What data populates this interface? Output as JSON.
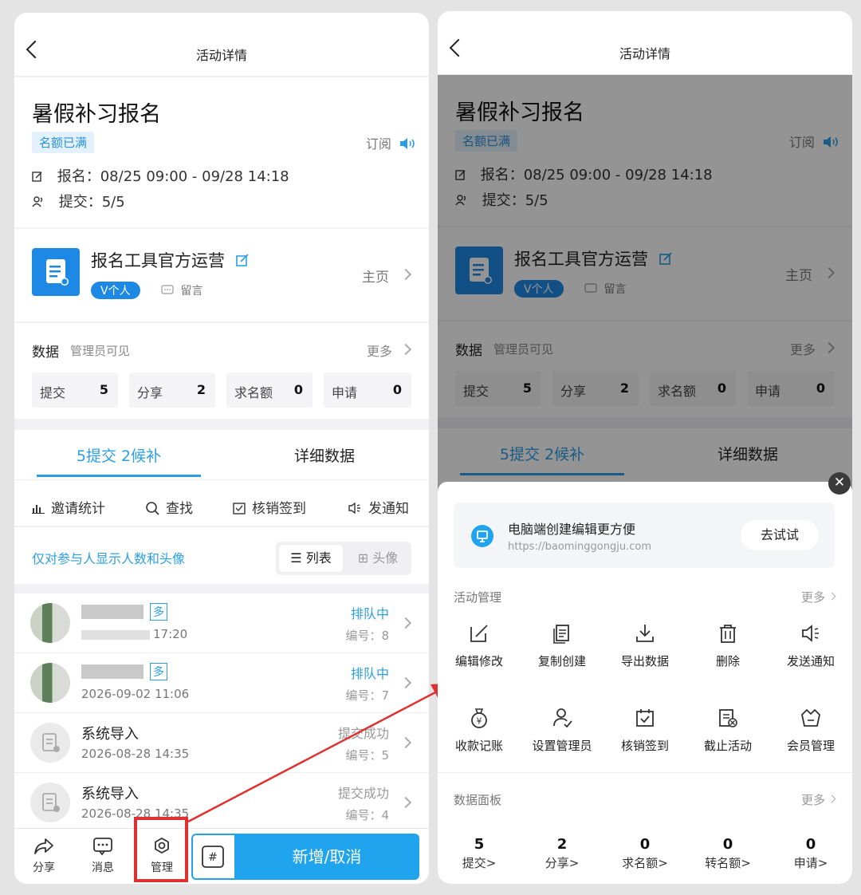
{
  "header": {
    "title": "活动详情"
  },
  "event": {
    "title": "暑假补习报名",
    "status_badge": "名额已满",
    "subscribe": "订阅",
    "signup_label": "报名：",
    "signup_period": "08/25 09:00 - 09/28 14:18",
    "submit_label": "提交：",
    "submit_value": "5/5"
  },
  "organizer": {
    "name": "报名工具官方运营",
    "badge": "V个人",
    "message": "留言",
    "homepage": "主页"
  },
  "data_section": {
    "title": "数据",
    "subtitle": "管理员可见",
    "more": "更多",
    "stats": [
      {
        "label": "提交",
        "value": "5"
      },
      {
        "label": "分享",
        "value": "2"
      },
      {
        "label": "求名额",
        "value": "0"
      },
      {
        "label": "申请",
        "value": "0"
      }
    ]
  },
  "tabs": [
    {
      "label": "5提交 2候补"
    },
    {
      "label": "详细数据"
    }
  ],
  "tools": [
    {
      "label": "邀请统计"
    },
    {
      "label": "查找"
    },
    {
      "label": "核销签到"
    },
    {
      "label": "发通知"
    }
  ],
  "list_options": {
    "note": "仅对参与人显示人数和头像",
    "list_view": "列表",
    "avatar_view": "头像"
  },
  "participants": [
    {
      "tag": "多",
      "time": "17:20",
      "status": "排队中",
      "number": "编号：8"
    },
    {
      "tag": "多",
      "time": "2026-09-02 11:06",
      "status": "排队中",
      "number": "编号：7"
    },
    {
      "name": "系统导入",
      "time": "2026-08-28 14:35",
      "status": "提交成功",
      "number": "编号：5"
    },
    {
      "name": "系统导入",
      "time": "2026-08-28 14:35",
      "status": "提交成功",
      "number": "编号：4"
    }
  ],
  "bottom_bar": {
    "share": "分享",
    "messages": "消息",
    "manage": "管理",
    "primary": "新增/取消"
  },
  "sheet": {
    "promo_title": "电脑端创建编辑更方便",
    "promo_url": "https://baominggongju.com",
    "promo_button": "去试试",
    "manage_title": "活动管理",
    "manage_more": "更多",
    "manage_items": [
      {
        "label": "编辑修改",
        "icon": "edit-icon"
      },
      {
        "label": "复制创建",
        "icon": "copy-icon"
      },
      {
        "label": "导出数据",
        "icon": "download-icon"
      },
      {
        "label": "删除",
        "icon": "trash-icon"
      },
      {
        "label": "发送通知",
        "icon": "speaker-icon"
      },
      {
        "label": "收款记账",
        "icon": "money-bag-icon"
      },
      {
        "label": "设置管理员",
        "icon": "admin-icon"
      },
      {
        "label": "核销签到",
        "icon": "check-calendar-icon"
      },
      {
        "label": "截止活动",
        "icon": "stop-icon"
      },
      {
        "label": "会员管理",
        "icon": "basket-icon"
      }
    ],
    "panel_title": "数据面板",
    "panel_more": "更多",
    "panel_items": [
      {
        "value": "5",
        "label": "提交>"
      },
      {
        "value": "2",
        "label": "分享>"
      },
      {
        "value": "0",
        "label": "求名额>"
      },
      {
        "value": "0",
        "label": "转名额>"
      },
      {
        "value": "0",
        "label": "申请>"
      }
    ]
  },
  "colors": {
    "accent": "#2b9ee5",
    "highlight": "#e03131",
    "primary_button": "#21a4ee"
  }
}
